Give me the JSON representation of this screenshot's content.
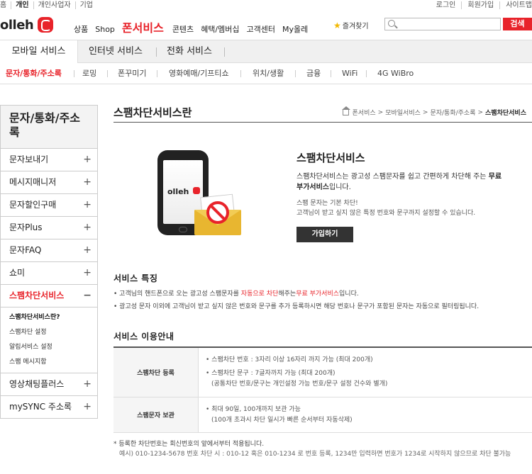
{
  "util": {
    "left": [
      "홈",
      "개인",
      "개인사업자",
      "기업"
    ],
    "right": [
      "로그인",
      "회원가입",
      "사이트맵"
    ]
  },
  "logo": {
    "text": "olleh"
  },
  "gnb": {
    "items": [
      "상품",
      "Shop",
      "폰서비스",
      "콘텐츠",
      "혜택/멤버십",
      "고객센터",
      "My올레"
    ],
    "active_index": 2,
    "favorite": "즐겨찾기",
    "search_placeholder": "",
    "search_button": "검색"
  },
  "tabs": [
    "모바일 서비스",
    "인터넷 서비스",
    "전화 서비스"
  ],
  "subnav": [
    "문자/통화/주소록",
    "로밍",
    "폰꾸미기",
    "영화예매/기프티쇼",
    "위치/생활",
    "금융",
    "WiFi",
    "4G WiBro"
  ],
  "lnb": {
    "title": "문자/통화/주소록",
    "items_top": [
      {
        "label": "문자보내기",
        "sign": "+"
      },
      {
        "label": "메시지매니저",
        "sign": "+"
      },
      {
        "label": "문자할인구매",
        "sign": "+"
      },
      {
        "label": "문자Plus",
        "sign": "+"
      },
      {
        "label": "문자FAQ",
        "sign": "+"
      },
      {
        "label": "쇼미",
        "sign": "+"
      },
      {
        "label": "스팸차단서비스",
        "sign": "−"
      }
    ],
    "sub_items": [
      "스팸차단서비스란?",
      "스팸차단 설정",
      "알림서비스 설정",
      "스팸 메시지함"
    ],
    "items_bottom": [
      {
        "label": "영상채팅플러스",
        "sign": "+"
      },
      {
        "label": "mySYNC 주소록",
        "sign": "+"
      }
    ]
  },
  "content": {
    "title": "스팸차단서비스란",
    "breadcrumb": [
      "폰서비스",
      "모바일서비스",
      "문자/통화/주소록",
      "스팸차단서비스"
    ],
    "phone_brand": "olleh",
    "hero": {
      "title": "스팸차단서비스",
      "desc_a": "스팸차단서비스는 광고성 스팸문자를 쉽고 간편하게 차단해 주는",
      "desc_b": "무료 부가서비스",
      "desc_c": "입니다.",
      "note1": "스팸 문자는 기본 차단!",
      "note2": "고객님이 받고 싶지 않은 특정 번호와 문구까지 설정할 수 있습니다.",
      "join_button": "가입하기"
    },
    "features_title": "서비스 특징",
    "features": {
      "f1_a": "• 고객님의 핸드폰으로 오는 광고성 스팸문자를 ",
      "f1_b": "자동으로 차단",
      "f1_c": "해주는",
      "f1_d": "무료 부가서비스",
      "f1_e": "입니다.",
      "f2": "• 광고성 문자 이외에 고객님이 받고 싶지 않은 번호와 문구를 추가 등록하시면 해당 번호나 문구가 포함된 문자는 자동으로 필터링됩니다."
    },
    "usage_title": "서비스 이용안내",
    "usage": [
      {
        "head": "스팸차단 등록",
        "lines": [
          "• 스팸차단 번호 : 3자리 이상 16자리 까지 가능 (최대 200개)",
          "• 스팸차단 문구 : 7글자까지 가능 (최대 200개)",
          "(공통차단 번호/문구는 개인설정 가능 번호/문구 설정 건수와 별개)"
        ]
      },
      {
        "head": "스팸문자 보관",
        "lines": [
          "• 최대 90일, 100개까지 보관 가능",
          "(100개 초과시 차단 일시가 빠른 순서부터 자동삭제)"
        ]
      }
    ],
    "footnote": "* 등록한 차단번호는 회신번호의 앞에서부터 적용됩니다.",
    "footnote_example": "예시) 010-1234-5678 번호 차단 시 : 010-12 혹은 010-1234 로 번호 등록, 1234만 입력하면 번호가 1234로 시작하지 않으므로 차단 불가능"
  },
  "colors": {
    "brand": "#e8232a",
    "dark_button": "#333333"
  }
}
